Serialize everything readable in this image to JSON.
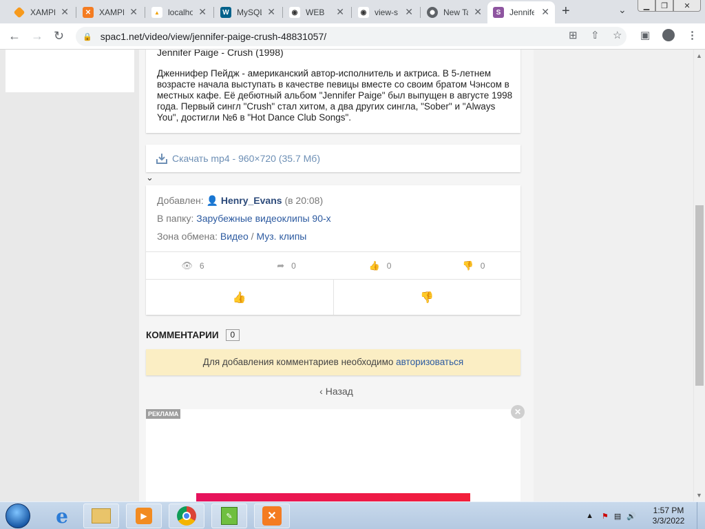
{
  "browser": {
    "tabs": [
      {
        "title": "XAMPP",
        "icon": "xampp-orange"
      },
      {
        "title": "XAMPP",
        "icon": "xampp"
      },
      {
        "title": "localhost",
        "icon": "phpmyadmin"
      },
      {
        "title": "MySQL",
        "icon": "mysql"
      },
      {
        "title": "WEB",
        "icon": "eye"
      },
      {
        "title": "view-s",
        "icon": "eye"
      },
      {
        "title": "New Tab",
        "icon": "chrome"
      },
      {
        "title": "Jennifer",
        "icon": "spaces-s",
        "active": true
      }
    ],
    "url": "spac1.net/video/view/jennifer-paige-crush-48831057/"
  },
  "video": {
    "title": "Jennifer Paige - Crush (1998)",
    "description": "Дженнифер Пейдж - американский автор-исполнитель и актриса. В 5-летнем возрасте начала выступать в качестве певицы вместе со своим братом Чэнсом в местных кафе. Её дебютный альбом \"Jennifer Paige\" был выпущен в августе 1998 года. Первый сингл \"Crush\" стал хитом, а два других сингла, \"Sober\" и \"Always You\", достигли №6 в \"Hot Dance Club Songs\".",
    "download_label": "Скачать mp4 - 960×720 (35.7 Мб)"
  },
  "meta": {
    "added_label": "Добавлен:",
    "author": "Henry_Evans",
    "added_time": "(в 20:08)",
    "folder_label": "В папку:",
    "folder": "Зарубежные видеоклипы 90-х",
    "zone_label": "Зона обмена:",
    "zone_section": "Видео",
    "zone_sep": "/",
    "zone_sub": "Муз. клипы"
  },
  "stats": {
    "views": "6",
    "shares": "0",
    "likes": "0",
    "dislikes": "0"
  },
  "comments": {
    "header": "КОММЕНТАРИИ",
    "count": "0",
    "notice_text": "Для добавления комментариев необходимо",
    "notice_link": "авторизоваться"
  },
  "back_label": "Назад",
  "ad": {
    "label": "РЕКЛАМА"
  },
  "taskbar": {
    "time": "1:57 PM",
    "date": "3/3/2022"
  }
}
